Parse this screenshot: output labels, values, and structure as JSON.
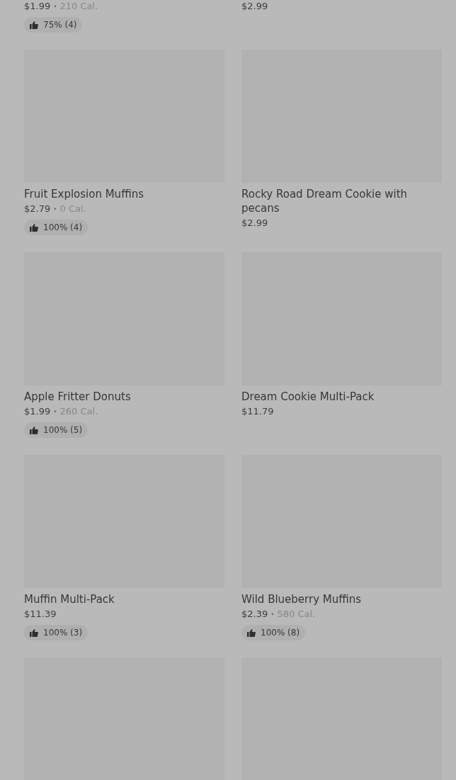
{
  "items": [
    {
      "price": "$1.99",
      "separator": "•",
      "calories": "210 Cal.",
      "rating": "75% (4)"
    },
    {
      "price": "$2.99"
    },
    {
      "image": true,
      "name": "Fruit Explosion Muffins",
      "price": "$2.79",
      "separator": "•",
      "calories": "0 Cal.",
      "rating": "100% (4)"
    },
    {
      "image": true,
      "name": "Rocky Road Dream Cookie with pecans",
      "price": "$2.99"
    },
    {
      "image": true,
      "name": "Apple Fritter Donuts",
      "price": "$1.99",
      "separator": "•",
      "calories": "260 Cal.",
      "rating": "100% (5)"
    },
    {
      "image": true,
      "name": "Dream Cookie Multi-Pack",
      "price": "$11.79"
    },
    {
      "image": true,
      "name": "Muffin Multi-Pack",
      "price": "$11.39",
      "rating": "100% (3)"
    },
    {
      "image": true,
      "name": "Wild Blueberry Muffins",
      "price": "$2.39",
      "separator": "•",
      "calories": "580 Cal.",
      "rating": "100% (8)"
    },
    {
      "image": true
    },
    {
      "image": true
    }
  ]
}
